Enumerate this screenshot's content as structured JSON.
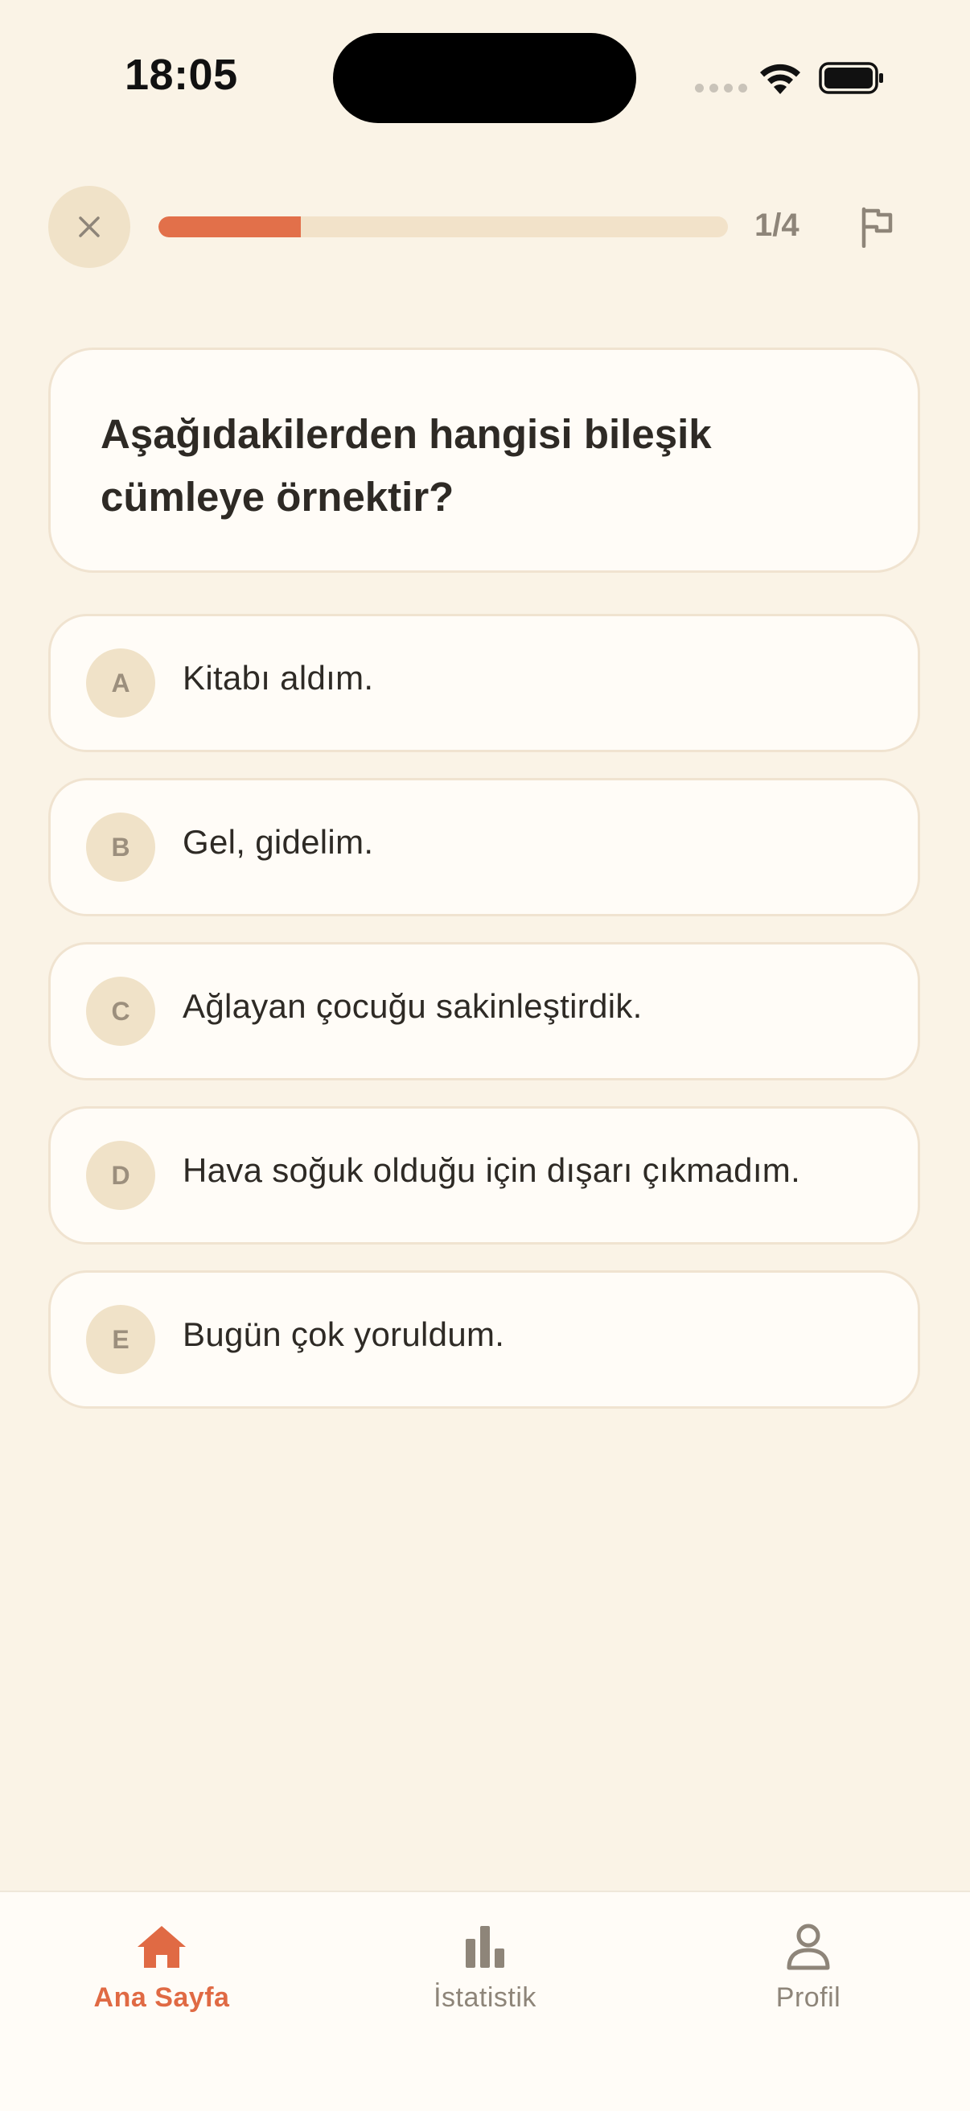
{
  "status_bar": {
    "time": "18:05"
  },
  "quiz_header": {
    "progress_label": "1/4",
    "progress_fraction": 0.25,
    "icons": {
      "close": "close-icon",
      "flag": "flag-icon"
    }
  },
  "question": {
    "text": "Aşağıdakilerden hangisi bileşik cümleye örnektir?"
  },
  "options": [
    {
      "letter": "A",
      "text": "Kitabı aldım."
    },
    {
      "letter": "B",
      "text": "Gel, gidelim."
    },
    {
      "letter": "C",
      "text": "Ağlayan çocuğu sakinleştirdik."
    },
    {
      "letter": "D",
      "text": "Hava soğuk olduğu için dışarı çıkmadım."
    },
    {
      "letter": "E",
      "text": "Bugün çok yoruldum."
    }
  ],
  "tab_bar": {
    "tabs": [
      {
        "label": "Ana Sayfa",
        "icon": "home-icon",
        "active": true
      },
      {
        "label": "İstatistik",
        "icon": "bar-chart-icon",
        "active": false
      },
      {
        "label": "Profil",
        "icon": "person-icon",
        "active": false
      }
    ]
  },
  "colors": {
    "background": "#FAF3E6",
    "accent": "#E2704A",
    "card": "#FFFCF7",
    "muted": "#8E8579"
  }
}
